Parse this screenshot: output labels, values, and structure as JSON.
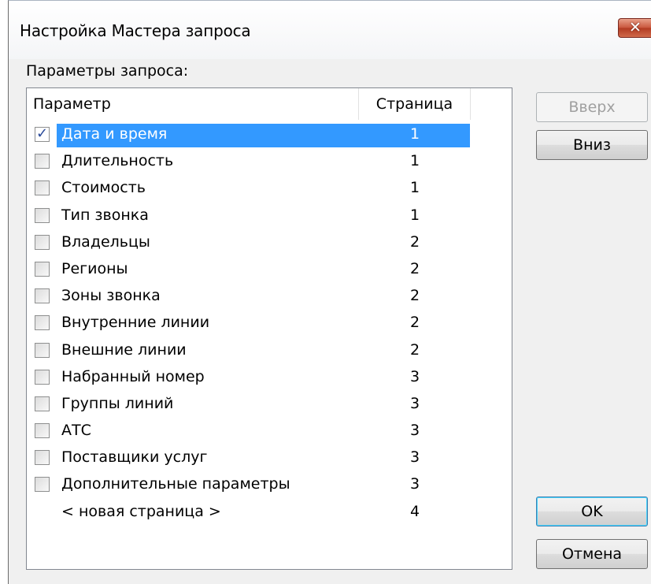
{
  "window": {
    "title": "Настройка Мастера запроса",
    "close_icon": "close-icon"
  },
  "params_label": "Параметры запроса:",
  "table": {
    "columns": [
      "Параметр",
      "Страница"
    ],
    "rows": [
      {
        "name": "Дата и время",
        "page": "1",
        "checked": true,
        "selected": true
      },
      {
        "name": "Длительность",
        "page": "1",
        "checked": false
      },
      {
        "name": "Стоимость",
        "page": "1",
        "checked": false
      },
      {
        "name": "Тип звонка",
        "page": "1",
        "checked": false
      },
      {
        "name": "Владельцы",
        "page": "2",
        "checked": false
      },
      {
        "name": "Регионы",
        "page": "2",
        "checked": false
      },
      {
        "name": "Зоны звонка",
        "page": "2",
        "checked": false
      },
      {
        "name": "Внутренние линии",
        "page": "2",
        "checked": false
      },
      {
        "name": "Внешние линии",
        "page": "2",
        "checked": false
      },
      {
        "name": "Набранный номер",
        "page": "3",
        "checked": false
      },
      {
        "name": "Группы линий",
        "page": "3",
        "checked": false
      },
      {
        "name": "АТС",
        "page": "3",
        "checked": false
      },
      {
        "name": "Поставщики услуг",
        "page": "3",
        "checked": false
      },
      {
        "name": "Дополнительные параметры",
        "page": "3",
        "checked": false
      },
      {
        "name": "< новая страница >",
        "page": "4",
        "checked": null
      }
    ]
  },
  "buttons": {
    "up": "Вверх",
    "down": "Вниз",
    "ok": "OK",
    "cancel": "Отмена"
  },
  "colors": {
    "selection": "#3399ff",
    "close_button": "#c8553b"
  }
}
